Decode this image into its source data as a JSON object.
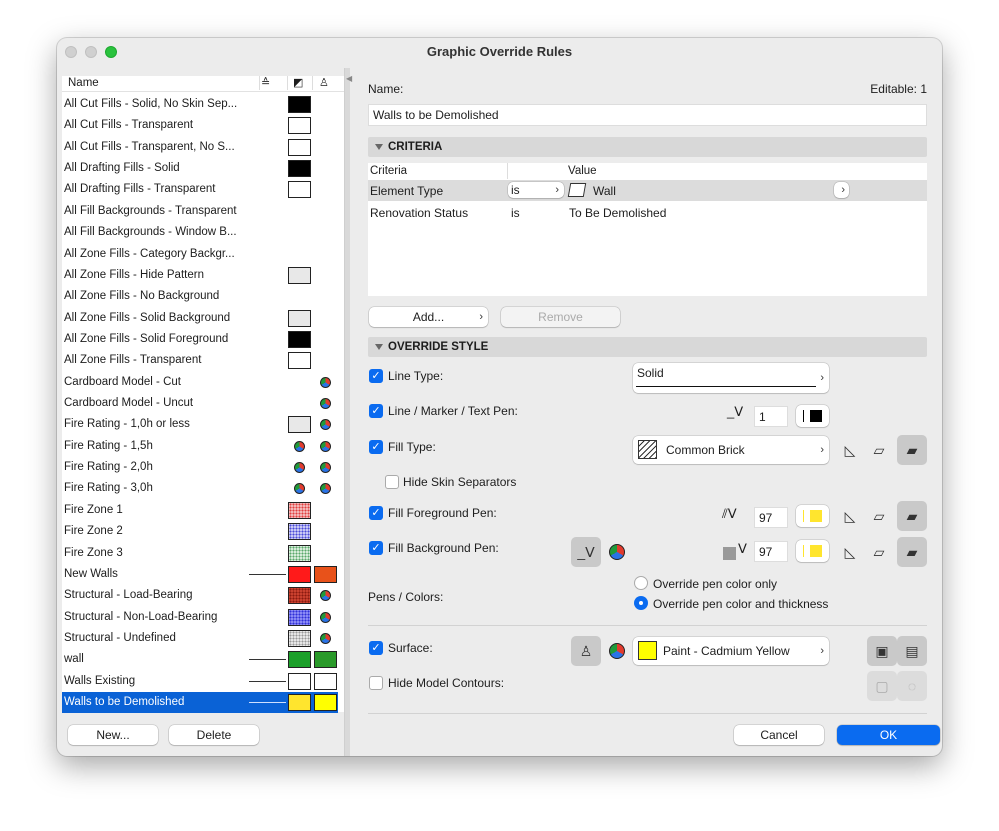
{
  "window": {
    "title": "Graphic Override Rules"
  },
  "list": {
    "header": {
      "name": "Name"
    },
    "rows": [
      {
        "label": "All Cut Fills - Solid, No Skin Sep...",
        "c1": "#000000"
      },
      {
        "label": "All Cut Fills - Transparent",
        "c1": "#ffffff"
      },
      {
        "label": "All Cut Fills - Transparent, No S...",
        "c1": "#ffffff"
      },
      {
        "label": "All Drafting Fills - Solid",
        "c1": "#000000"
      },
      {
        "label": "All Drafting Fills - Transparent",
        "c1": "#ffffff"
      },
      {
        "label": "All Fill Backgrounds - Transparent"
      },
      {
        "label": "All Fill Backgrounds - Window B..."
      },
      {
        "label": "All Zone Fills - Category Backgr..."
      },
      {
        "label": "All Zone Fills - Hide Pattern",
        "c1": "#e8e8e8"
      },
      {
        "label": "All Zone Fills - No Background"
      },
      {
        "label": "All Zone Fills - Solid Background",
        "c1": "#e8e8e8"
      },
      {
        "label": "All Zone Fills - Solid Foreground",
        "c1": "#000000"
      },
      {
        "label": "All Zone Fills - Transparent",
        "c1": "#ffffff"
      },
      {
        "label": "Cardboard Model - Cut",
        "c2": "wheel"
      },
      {
        "label": "Cardboard Model - Uncut",
        "c2": "wheel"
      },
      {
        "label": "Fire Rating - 1,0h or less",
        "c1": "#e8e8e8",
        "c2": "wheel"
      },
      {
        "label": "Fire Rating - 1,5h",
        "c1": "wheel",
        "c2": "wheel"
      },
      {
        "label": "Fire Rating - 2,0h",
        "c1": "wheel",
        "c2": "wheel"
      },
      {
        "label": "Fire Rating - 3,0h",
        "c1": "wheel",
        "c2": "wheel"
      },
      {
        "label": "Fire Zone 1",
        "c1": "pat:#f3b7b7:#e04040"
      },
      {
        "label": "Fire Zone 2",
        "c1": "pat:#c8c8f5:#4a4ad8"
      },
      {
        "label": "Fire Zone 3",
        "c1": "pat:#d6ecd9:#5aa86a"
      },
      {
        "label": "New Walls",
        "line": true,
        "c1": "#ff1a1a",
        "c2": "#e8521a"
      },
      {
        "label": "Structural - Load-Bearing",
        "c1": "pat:#c9402e:#8a1a10",
        "c2": "wheel"
      },
      {
        "label": "Structural - Non-Load-Bearing",
        "c1": "pat:#8a8af5:#3030d8",
        "c2": "wheel"
      },
      {
        "label": "Structural - Undefined",
        "c1": "pat:#e6e6e6:#999999",
        "c2": "wheel"
      },
      {
        "label": "wall",
        "line": true,
        "c1": "#1ca02a",
        "c2": "#2a9a2a"
      },
      {
        "label": "Walls Existing",
        "line": true,
        "c1": "#ffffff",
        "c2": "#ffffff"
      },
      {
        "label": "Walls to be Demolished",
        "line": true,
        "c1": "#ffe52e",
        "c2": "#ffff00",
        "selected": true
      }
    ],
    "new_label": "New...",
    "delete_label": "Delete"
  },
  "editor": {
    "name_label": "Name:",
    "editable": "Editable: 1",
    "name_value": "Walls to be Demolished",
    "criteria": {
      "title": "CRITERIA",
      "col_criteria": "Criteria",
      "col_value": "Value",
      "rows": [
        {
          "criteria": "Element Type",
          "op": "is",
          "value": "Wall"
        },
        {
          "criteria": "Renovation Status",
          "op": "is",
          "value": "To Be Demolished"
        }
      ],
      "add_label": "Add...",
      "remove_label": "Remove"
    },
    "override": {
      "title": "OVERRIDE STYLE",
      "line_type_label": "Line Type:",
      "line_type_value": "Solid",
      "pen_label": "Line / Marker / Text Pen:",
      "pen_value": "1",
      "fill_type_label": "Fill Type:",
      "fill_type_value": "Common Brick",
      "hide_skin_label": "Hide Skin Separators",
      "fg_label": "Fill Foreground Pen:",
      "fg_value": "97",
      "bg_label": "Fill Background Pen:",
      "bg_value": "97",
      "pens_colors_label": "Pens / Colors:",
      "radio1": "Override pen color only",
      "radio2": "Override pen color and thickness",
      "surface_label": "Surface:",
      "surface_value": "Paint - Cadmium Yellow",
      "hide_contours_label": "Hide Model Contours:"
    },
    "cancel_label": "Cancel",
    "ok_label": "OK"
  },
  "colors": {
    "accent": "#0a6bf0",
    "selection": "#0a62d6",
    "yellow": "#ffee00"
  }
}
